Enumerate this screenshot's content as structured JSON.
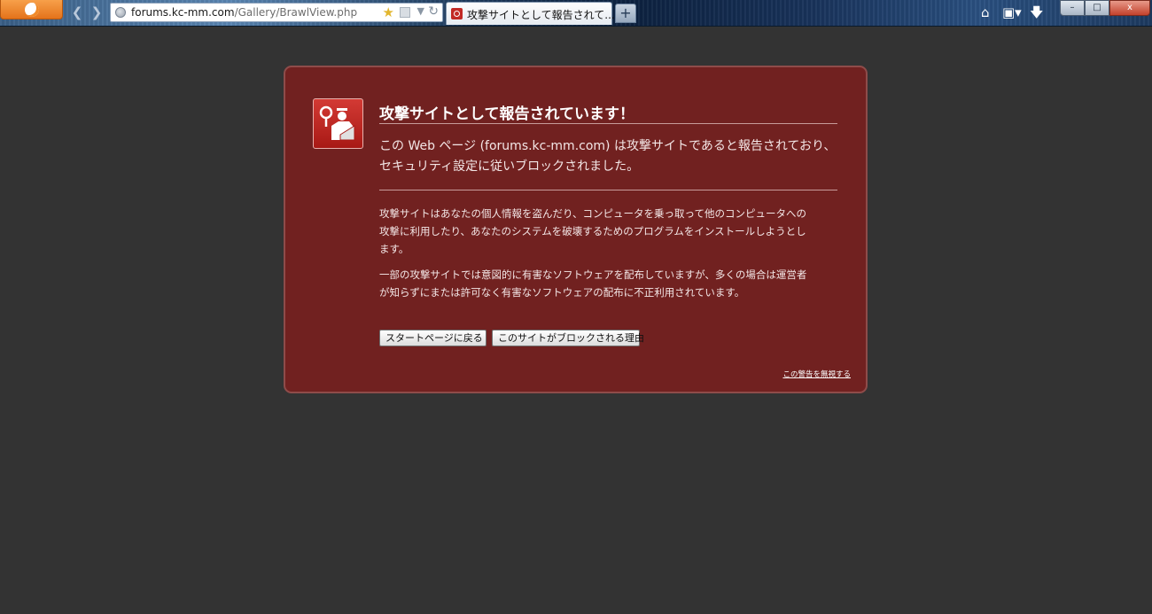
{
  "browser": {
    "url_host": "forums.kc-mm.com",
    "url_path": "/Gallery/BrawlView.php",
    "tab_title": "攻撃サイトとして報告されて...",
    "new_tab_label": "+",
    "window_controls": {
      "minimize": "–",
      "maximize": "□",
      "close": "x"
    }
  },
  "icons": {
    "app_menu": "firefox-app-button",
    "back": "back-arrow-icon",
    "forward": "forward-arrow-icon",
    "home": "home-icon",
    "bookmarks": "bookmarks-icon",
    "downloads": "download-arrow-icon",
    "warning": "policeman-stop-icon"
  },
  "colors": {
    "page_bg": "#333333",
    "panel_bg": "#712120",
    "panel_border": "#8e4c4a",
    "icon_red": "#c22a25"
  },
  "warning": {
    "title": "攻撃サイトとして報告されています！",
    "lead": "この Web ページ (forums.kc-mm.com) は攻撃サイトであると報告されており、セキュリティ設定に従いブロックされました。",
    "paragraph1": "攻撃サイトはあなたの個人情報を盗んだり、コンピュータを乗っ取って他のコンピュータへの攻撃に利用したり、あなたのシステムを破壊するためのプログラムをインストールしようとします。",
    "paragraph2": "一部の攻撃サイトでは意図的に有害なソフトウェアを配布していますが、多くの場合は運営者が知らずにまたは許可なく有害なソフトウェアの配布に不正利用されています。",
    "button_home": "スタートページに戻る",
    "button_why": "このサイトがブロックされる理由",
    "ignore_link": "この警告を無視する"
  }
}
